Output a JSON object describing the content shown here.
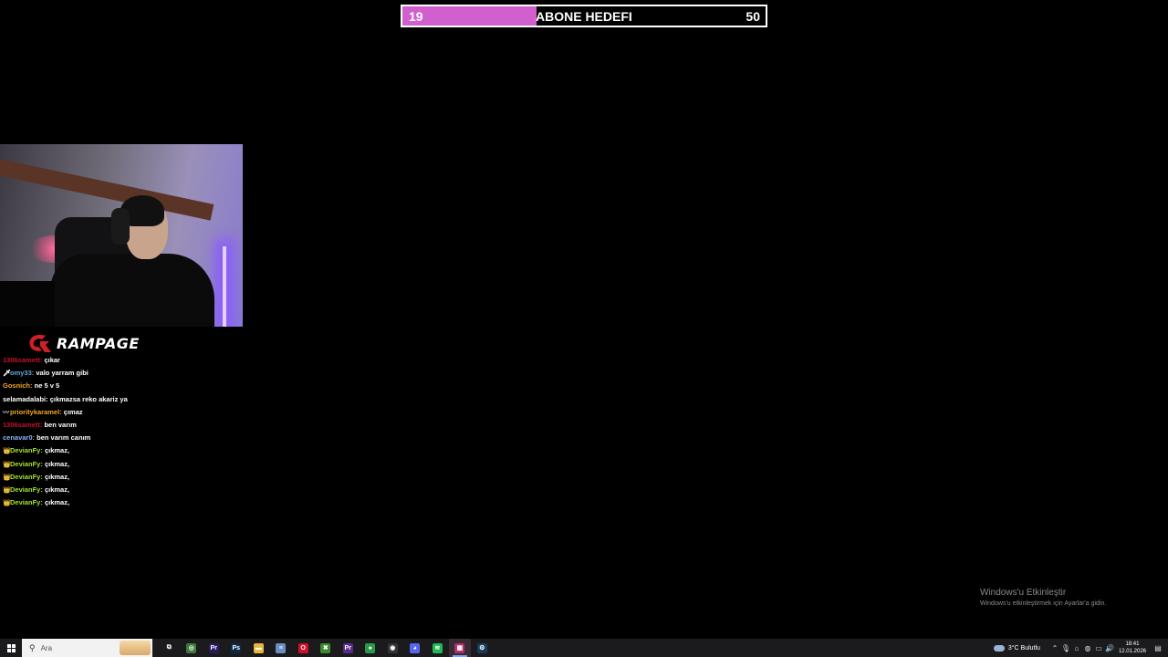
{
  "goal": {
    "current": "19",
    "title": "ABONE HEDEFI",
    "target": "50",
    "progress": 0.37,
    "fill_color": "#d15fce"
  },
  "logo": {
    "text": "RAMPAGE",
    "color": "#d11f2a"
  },
  "chat": [
    {
      "badge": "",
      "user": "1306samett:",
      "user_color": "#c8102e",
      "msg": "çıkar"
    },
    {
      "badge": "🗡",
      "user": "omy33:",
      "user_color": "#5aa9e6",
      "msg": "valo yarram gibi"
    },
    {
      "badge": "",
      "user": "Gosnich:",
      "user_color": "#f5a623",
      "msg": "ne 5 v 5"
    },
    {
      "badge": "",
      "user": "selamadalabi:",
      "user_color": "#ffffff",
      "msg": "çıkmazsa reko akariz ya"
    },
    {
      "badge": "〰",
      "user": "prioritykaramel:",
      "user_color": "#f5a623",
      "msg": "çımaz"
    },
    {
      "badge": "",
      "user": "1306samett:",
      "user_color": "#c8102e",
      "msg": "ben varım"
    },
    {
      "badge": "",
      "user": "cenavar0:",
      "user_color": "#8ab4f8",
      "msg": "ben varım canım"
    },
    {
      "badge": "👑",
      "user": "DevianFy:",
      "user_color": "#a6e22e",
      "msg": "çıkmaz,"
    },
    {
      "badge": "👑",
      "user": "DevianFy:",
      "user_color": "#a6e22e",
      "msg": "çıkmaz,"
    },
    {
      "badge": "👑",
      "user": "DevianFy:",
      "user_color": "#a6e22e",
      "msg": "çıkmaz,"
    },
    {
      "badge": "👑",
      "user": "DevianFy:",
      "user_color": "#a6e22e",
      "msg": "çıkmaz,"
    },
    {
      "badge": "👑",
      "user": "DevianFy:",
      "user_color": "#a6e22e",
      "msg": "çıkmaz,"
    }
  ],
  "watermark": {
    "title": "Windows'u Etkinleştir",
    "subtitle": "Windows'u etkinleştirmek için Ayarlar'a gidin."
  },
  "taskbar": {
    "search_placeholder": "Ara",
    "apps": [
      {
        "name": "task-view",
        "label": "⧉",
        "color": "#1b1b1d"
      },
      {
        "name": "xbox",
        "label": "◎",
        "color": "#3a7a3a"
      },
      {
        "name": "premiere",
        "label": "Pr",
        "color": "#2a1a5e"
      },
      {
        "name": "photoshop",
        "label": "Ps",
        "color": "#0b2a4a"
      },
      {
        "name": "file-explorer",
        "label": "▬",
        "color": "#e8b63a"
      },
      {
        "name": "notepad",
        "label": "≡",
        "color": "#6a8fc0"
      },
      {
        "name": "opera",
        "label": "O",
        "color": "#d0102a"
      },
      {
        "name": "minecraft",
        "label": "✖",
        "color": "#3c8a2e"
      },
      {
        "name": "premiere-2",
        "label": "Pr",
        "color": "#5a2a8a"
      },
      {
        "name": "chrome",
        "label": "●",
        "color": "#2a9a4a"
      },
      {
        "name": "obs",
        "label": "◉",
        "color": "#333333"
      },
      {
        "name": "discord",
        "label": "◕",
        "color": "#5865f2"
      },
      {
        "name": "spotify",
        "label": "≋",
        "color": "#1db954"
      },
      {
        "name": "rampage-app",
        "label": "▦",
        "color": "#b0306a"
      },
      {
        "name": "steam",
        "label": "⚙",
        "color": "#1a3a5a"
      }
    ],
    "weather": "3°C Bulutlu",
    "time": "18:41",
    "date": "12.01.2026"
  }
}
